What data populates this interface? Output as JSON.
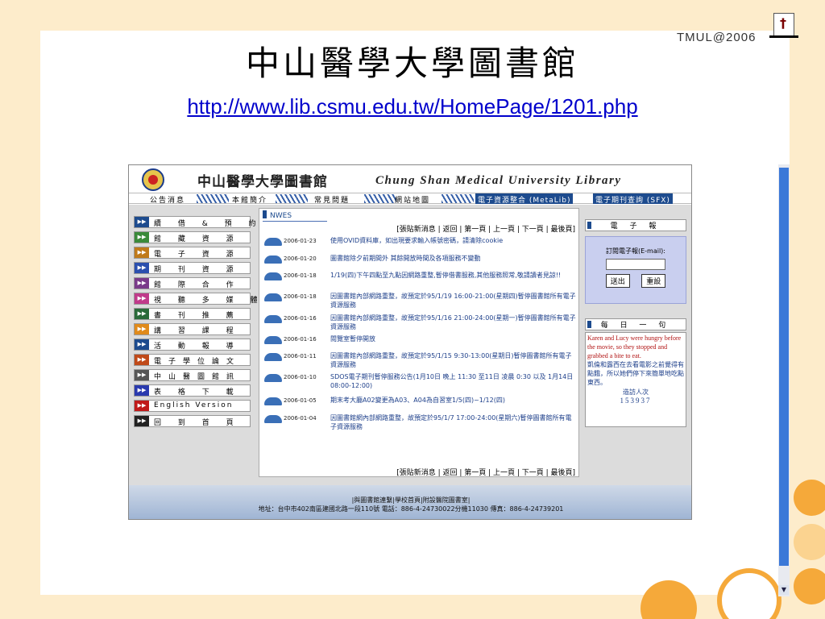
{
  "slide": {
    "title": "中山醫學大學圖書館",
    "url": "http://www.lib.csmu.edu.tw/HomePage/1201.php",
    "tag": "TMUL@2006"
  },
  "site": {
    "name_cn": "中山醫學大學圖書館",
    "name_en": "Chung Shan Medical University Library",
    "nav": [
      "公告消息",
      "本館簡介",
      "常見問題",
      "網站地圖"
    ],
    "nav_selected_1": "電子資源整合 (MetaLib)",
    "nav_selected_2": "電子期刊查詢 (SFX)",
    "sidebar": [
      {
        "label": "續 借 & 預 約",
        "color": "#1d4b8e"
      },
      {
        "label": "館 藏 資 源",
        "color": "#3a8a3a"
      },
      {
        "label": "電 子 資 源",
        "color": "#c07a1a"
      },
      {
        "label": "期 刊 資 源",
        "color": "#2a4fae"
      },
      {
        "label": "館 際 合 作",
        "color": "#7a3a8a"
      },
      {
        "label": "視 聽 多 媒 體",
        "color": "#c03a8a"
      },
      {
        "label": "書 刊 推 薦",
        "color": "#2a6a3a"
      },
      {
        "label": "講 習 課 程",
        "color": "#e08a1a"
      },
      {
        "label": "活 動 報 導",
        "color": "#1d4b8e"
      },
      {
        "label": "電子學位論文",
        "color": "#c04a1a"
      },
      {
        "label": "中山醫圖館訊",
        "color": "#555555"
      },
      {
        "label": "表 格 下 載",
        "color": "#2a3aae"
      },
      {
        "label": "English Version",
        "color": "#c01a1a"
      },
      {
        "label": "回 到 首 頁",
        "color": "#222222"
      }
    ],
    "news_title": "NWES",
    "news_links": "[張貼新消息 | 返回 | 第一頁 | 上一頁 | 下一頁 | 最後頁]",
    "news": [
      {
        "date": "2006-01-23",
        "text": "使用OVID資料庫，如出現要求輸入帳號密碼，請清除cookie"
      },
      {
        "date": "2006-01-20",
        "text": "圖書館除夕前期間外 其餘開放時間及各項服務不變動"
      },
      {
        "date": "2006-01-18",
        "text": "1/19(四)下午四點至九點因網路重整,暫停借書服務,其他服務照常,敬請讀者見諒!!"
      },
      {
        "date": "2006-01-18",
        "text": "因圖書館內部網路重整，故預定於95/1/19 16:00-21:00(星期四)暫停圖書館所有電子資源服務"
      },
      {
        "date": "2006-01-16",
        "text": "因圖書館內部網路重整，故預定於95/1/16 21:00-24:00(星期一)暫停圖書館所有電子資源服務"
      },
      {
        "date": "2006-01-16",
        "text": "閱覽室暫停開放"
      },
      {
        "date": "2006-01-11",
        "text": "因圖書館內部網路重整，故預定於95/1/15 9:30-13:00(星期日)暫停圖書館所有電子資源服務"
      },
      {
        "date": "2006-01-10",
        "text": "SDOS電子期刊暫停服務公告(1月10日 晚上 11:30 至11日 凌晨 0:30 以及 1月14日 08:00-12:00)"
      },
      {
        "date": "2006-01-05",
        "text": "期末考大廳A02變更為A03、A04為自習室1/5(四)~1/12(四)"
      },
      {
        "date": "2006-01-04",
        "text": "因圖書館網內部網路重整，故預定於95/1/7 17:00-24:00(星期六)暫停圖書館所有電子資源服務"
      }
    ],
    "epaper": {
      "title": "電 子 報",
      "subscribe_label": "訂閱電子報(E-mail):",
      "submit": "送出",
      "reset": "重設"
    },
    "quote": {
      "title": "每 日 一 句",
      "en": "Karen and Lucy were hungry before the movie, so they stopped and grabbed a bite to eat.",
      "cn": "凱倫和露西在去看電影之前覺得有點餓，所以她們停下來簡單地吃點東西。",
      "visits_label": "造訪人次",
      "visits": "153937"
    },
    "footer": {
      "links": "|與圖書館連繫|學校首頁|附設醫院圖書室|",
      "address": "地址：台中市402南區建國北路一段110號 電話：886-4-24730022分機11030 傳真：886-4-24739201"
    }
  }
}
